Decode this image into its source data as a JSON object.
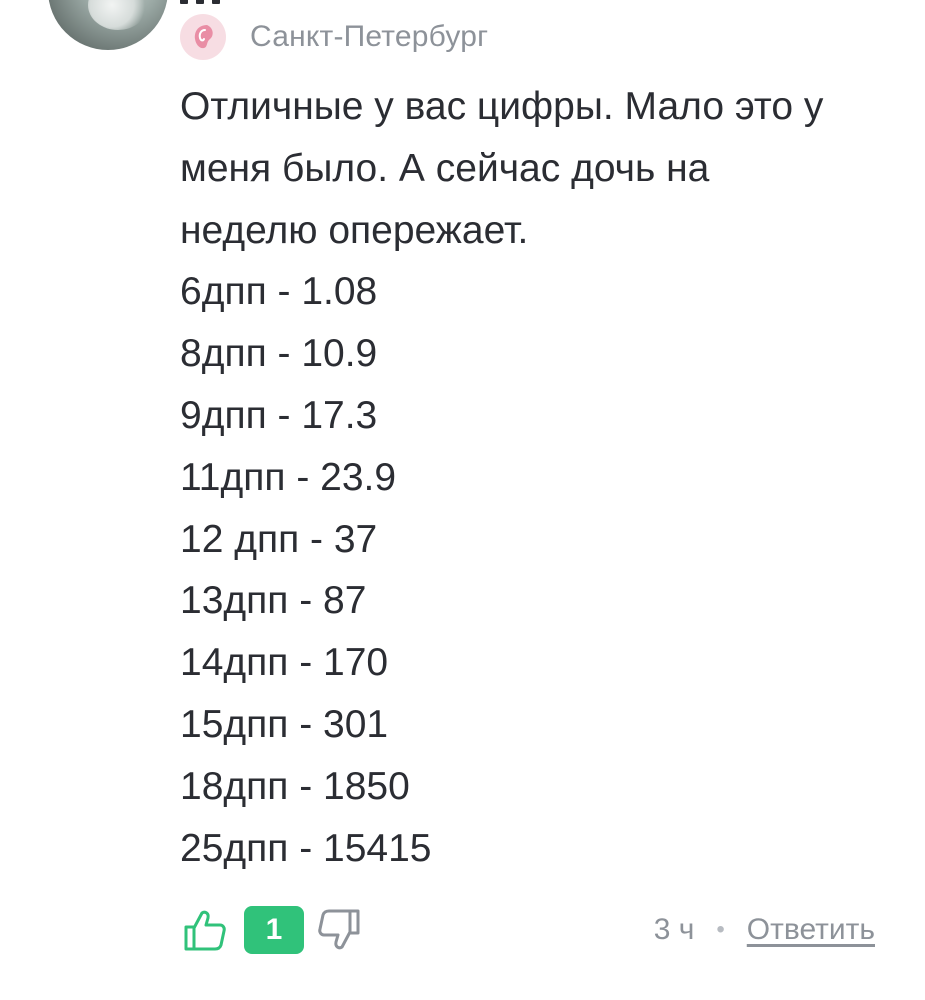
{
  "author": {
    "city": "Санкт-Петербург",
    "badge_icon": "pink-ear-icon",
    "avatar_icon": "user-avatar"
  },
  "comment": {
    "paragraph": [
      "Отличные у вас цифры. Мало это у",
      "меня было. А сейчас дочь на",
      "неделю опережает."
    ],
    "lines": [
      "6дпп - 1.08",
      "8дпп - 10.9",
      "9дпп - 17.3",
      "11дпп - 23.9",
      "12 дпп - 37",
      "13дпп - 87",
      "14дпп - 170",
      "15дпп - 301",
      "18дпп - 1850",
      "25дпп - 15415"
    ]
  },
  "actions": {
    "like_icon": "thumbs-up-icon",
    "like_count": "1",
    "dislike_icon": "thumbs-down-icon",
    "time": "3 ч",
    "separator": "•",
    "reply_label": "Ответить"
  },
  "colors": {
    "accent_green": "#30c27a",
    "muted_text": "#8d9299",
    "body_text": "#2b2d33",
    "badge_pink": "#f7dde3"
  }
}
